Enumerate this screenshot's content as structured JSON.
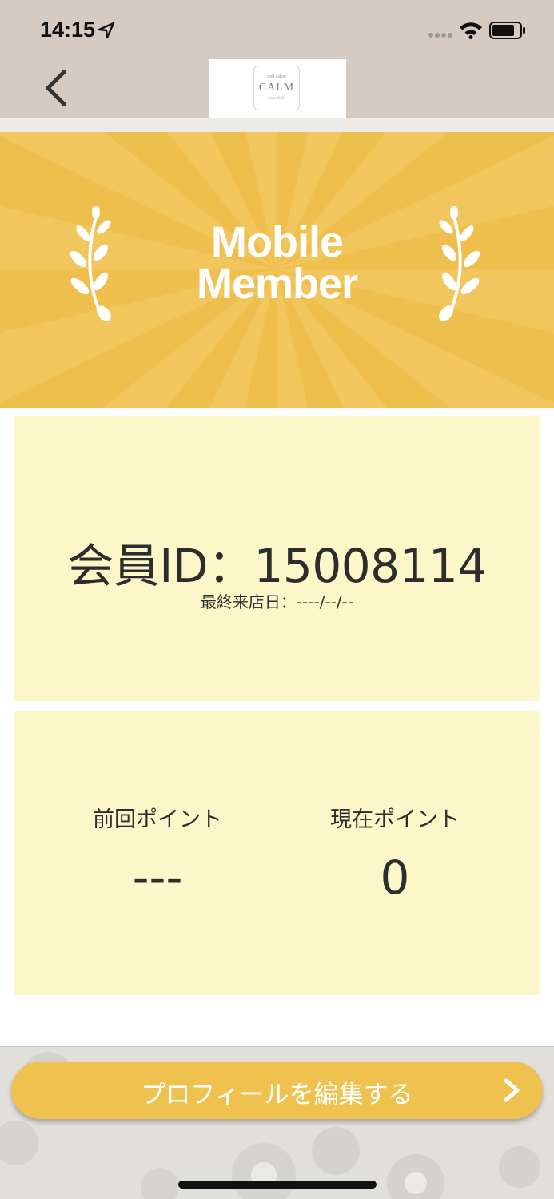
{
  "status_bar": {
    "time": "14:15"
  },
  "header": {
    "logo": {
      "top": "nail salon",
      "text": "CALM",
      "sub": "since 2019"
    }
  },
  "banner": {
    "title_line1": "Mobile",
    "title_line2": "Member"
  },
  "member_card": {
    "member_id": "会員ID：15008114",
    "last_visit": "最終来店日：----/--/--"
  },
  "points": {
    "previous": {
      "label": "前回ポイント",
      "value": "---"
    },
    "current": {
      "label": "現在ポイント",
      "value": "0"
    }
  },
  "footer": {
    "edit_button_label": "プロフィールを編集する"
  },
  "colors": {
    "banner": "#efbf4e",
    "card": "#fbf7c8",
    "button": "#efc250",
    "header": "#d6cbc3"
  },
  "icons": [
    "location-arrow-icon",
    "signal-icon",
    "wifi-icon",
    "battery-icon",
    "back-chevron-icon",
    "laurel-icon",
    "chevron-right-icon"
  ]
}
